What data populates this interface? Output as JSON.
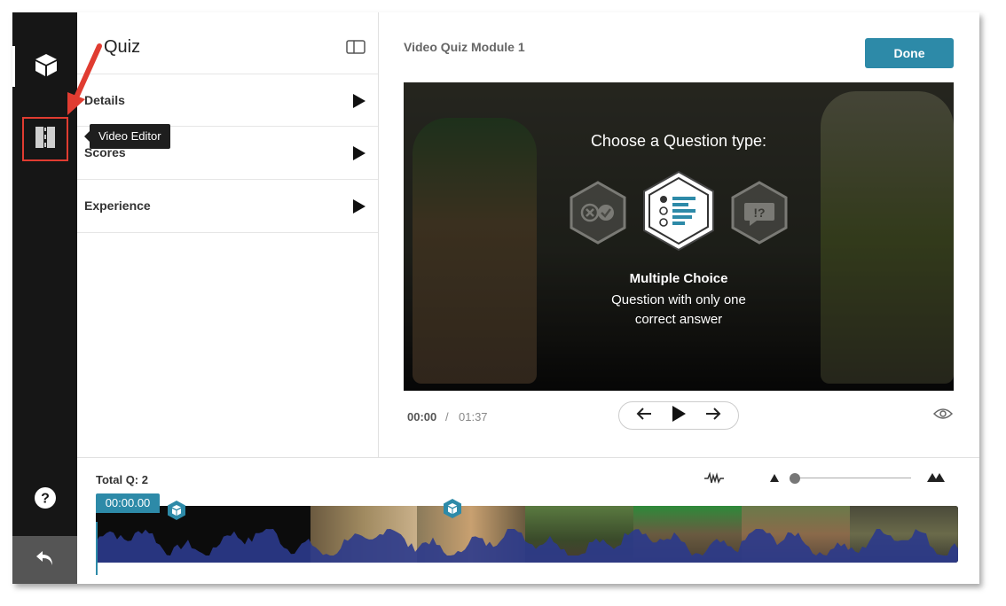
{
  "settings": {
    "title": "Quiz",
    "rows": [
      {
        "label": "Details"
      },
      {
        "label": "Scores"
      },
      {
        "label": "Experience"
      }
    ]
  },
  "tooltip": {
    "text": "Video Editor"
  },
  "header": {
    "module_title": "Video Quiz Module 1",
    "done_label": "Done"
  },
  "video": {
    "heading": "Choose a Question type:",
    "selected_type": {
      "title": "Multiple Choice",
      "description": "Question with only one correct answer"
    },
    "question_types": [
      {
        "icon": "true-false-icon",
        "selected": false
      },
      {
        "icon": "multiple-choice-icon",
        "selected": true
      },
      {
        "icon": "open-question-icon",
        "selected": false
      }
    ]
  },
  "player": {
    "current_time": "00:00",
    "separator": "/",
    "total_time": "01:37"
  },
  "timeline": {
    "total_questions": "Total Q: 2",
    "playhead_time": "00:00.00",
    "zoom_level": 0.0,
    "question_markers": 2
  },
  "colors": {
    "accent": "#2d8aa8",
    "rail": "#161616",
    "annotation": "#e03c31",
    "waveform": "#2b3a8c"
  }
}
